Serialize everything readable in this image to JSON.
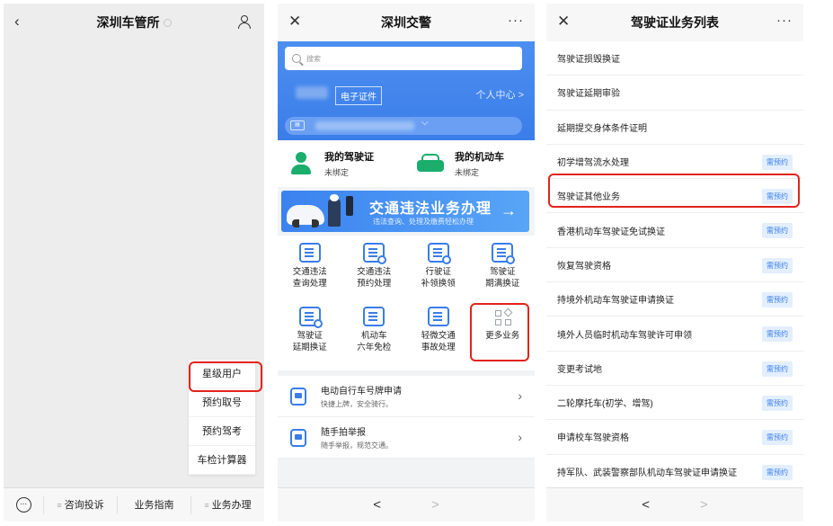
{
  "panel1": {
    "header": {
      "back_icon": "chevron-left-icon",
      "title": "深圳车管所",
      "user_icon": "user-icon"
    },
    "menu_popup": [
      "星级用户",
      "预约取号",
      "预约驾考",
      "车检计算器"
    ],
    "bottom_menu": [
      "咨询投诉",
      "业务指南",
      "业务办理"
    ],
    "accent_red": "#e2231a"
  },
  "panel2": {
    "header": {
      "close_icon": "close-icon",
      "title": "深圳交警",
      "more": "···"
    },
    "search_placeholder": "搜索",
    "ecert": "电子证件",
    "personal_center": "个人中心 >",
    "my_items": [
      {
        "title": "我的驾驶证",
        "status": "未绑定",
        "icon": "person-icon"
      },
      {
        "title": "我的机动车",
        "status": "未绑定",
        "icon": "car-icon"
      }
    ],
    "banner": {
      "title": "交通违法业务办理",
      "subtitle": "违法查询、处理及缴费轻松办理",
      "arrow": "→"
    },
    "grid": [
      {
        "l1": "交通违法",
        "l2": "查询处理",
        "icon": "violation-icon"
      },
      {
        "l1": "交通违法",
        "l2": "预约处理",
        "icon": "calendar-icon"
      },
      {
        "l1": "行驶证",
        "l2": "补领换领",
        "icon": "license-icon"
      },
      {
        "l1": "驾驶证",
        "l2": "期满换证",
        "icon": "id-card-icon"
      },
      {
        "l1": "驾驶证",
        "l2": "延期换证",
        "icon": "id-card-icon"
      },
      {
        "l1": "机动车",
        "l2": "六年免检",
        "icon": "exempt-icon"
      },
      {
        "l1": "轻微交通",
        "l2": "事故处理",
        "icon": "accident-icon"
      },
      {
        "l1": "更多业务",
        "l2": "",
        "icon": "grid-icon"
      }
    ],
    "list": [
      {
        "title": "电动自行车号牌申请",
        "sub": "快捷上牌，安全骑行。"
      },
      {
        "title": "随手拍举报",
        "sub": "随手举报，规范交通。"
      }
    ],
    "accent_blue": "#3a7de8",
    "accent_green": "#1aad6b"
  },
  "panel3": {
    "header": {
      "close_icon": "close-icon",
      "title": "驾驶证业务列表",
      "more": "···"
    },
    "rows": [
      {
        "text": "驾驶证损毁换证",
        "badge": ""
      },
      {
        "text": "驾驶证延期审验",
        "badge": ""
      },
      {
        "text": "延期提交身体条件证明",
        "badge": ""
      },
      {
        "text": "初学增驾流水处理",
        "badge": "需预约"
      },
      {
        "text": "驾驶证其他业务",
        "badge": "需预约"
      },
      {
        "text": "香港机动车驾驶证免试换证",
        "badge": "需预约"
      },
      {
        "text": "恢复驾驶资格",
        "badge": "需预约"
      },
      {
        "text": "持境外机动车驾驶证申请换证",
        "badge": "需预约"
      },
      {
        "text": "境外人员临时机动车驾驶许可申领",
        "badge": "需预约"
      },
      {
        "text": "变更考试地",
        "badge": "需预约"
      },
      {
        "text": "二轮摩托车(初学、增驾)",
        "badge": "需预约"
      },
      {
        "text": "申请校车驾驶资格",
        "badge": "需预约"
      },
      {
        "text": "持军队、武装警察部队机动车驾驶证申请换证",
        "badge": "需预约"
      }
    ]
  },
  "nav": {
    "prev": "<",
    "next": ">"
  }
}
